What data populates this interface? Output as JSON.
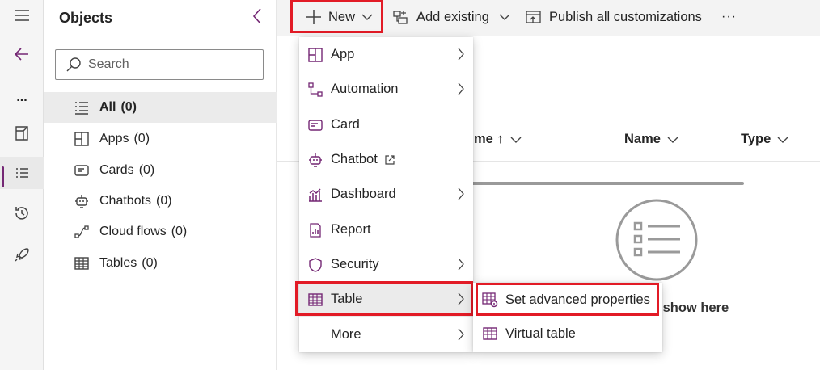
{
  "colors": {
    "accent": "#742774",
    "highlight": "#e21b26",
    "icon_purple": "#742774"
  },
  "rail": {
    "items": [
      {
        "icon": "hamburger-icon"
      },
      {
        "icon": "back-arrow-icon"
      },
      {
        "icon": "more-icon",
        "label": "..."
      },
      {
        "icon": "overview-icon"
      },
      {
        "icon": "objects-icon",
        "active": true
      },
      {
        "icon": "history-icon"
      },
      {
        "icon": "rocket-icon"
      }
    ]
  },
  "objects_panel": {
    "title": "Objects",
    "search_placeholder": "Search",
    "items": [
      {
        "label": "All",
        "count": "(0)",
        "icon": "list-icon"
      },
      {
        "label": "Apps",
        "count": "(0)",
        "icon": "apps-icon"
      },
      {
        "label": "Cards",
        "count": "(0)",
        "icon": "card-icon"
      },
      {
        "label": "Chatbots",
        "count": "(0)",
        "icon": "chatbot-icon"
      },
      {
        "label": "Cloud flows",
        "count": "(0)",
        "icon": "flow-icon"
      },
      {
        "label": "Tables",
        "count": "(0)",
        "icon": "table-icon"
      }
    ]
  },
  "commandbar": {
    "new_label": "New",
    "add_existing_label": "Add existing",
    "publish_label": "Publish all customizations",
    "more_label": "···"
  },
  "table": {
    "columns": [
      {
        "label": "me ↑",
        "sortable": true
      },
      {
        "label": "Name"
      },
      {
        "label": "Type"
      }
    ]
  },
  "empty_state": {
    "text": "hing to show here"
  },
  "new_menu": {
    "items": [
      {
        "label": "App",
        "icon": "app-icon",
        "submenu": true
      },
      {
        "label": "Automation",
        "icon": "automation-icon",
        "submenu": true
      },
      {
        "label": "Card",
        "icon": "card-icon",
        "submenu": false
      },
      {
        "label": "Chatbot",
        "icon": "chatbot-icon",
        "submenu": false,
        "external": true
      },
      {
        "label": "Dashboard",
        "icon": "dashboard-icon",
        "submenu": true
      },
      {
        "label": "Report",
        "icon": "report-icon",
        "submenu": false
      },
      {
        "label": "Security",
        "icon": "shield-icon",
        "submenu": true
      },
      {
        "label": "Table",
        "icon": "table-icon",
        "submenu": true,
        "active": true
      },
      {
        "label": "More",
        "icon": "",
        "submenu": true
      }
    ]
  },
  "table_submenu": {
    "items": [
      {
        "label": "Set advanced properties",
        "icon": "table-settings-icon"
      },
      {
        "label": "Virtual table",
        "icon": "virtual-table-icon"
      }
    ]
  }
}
